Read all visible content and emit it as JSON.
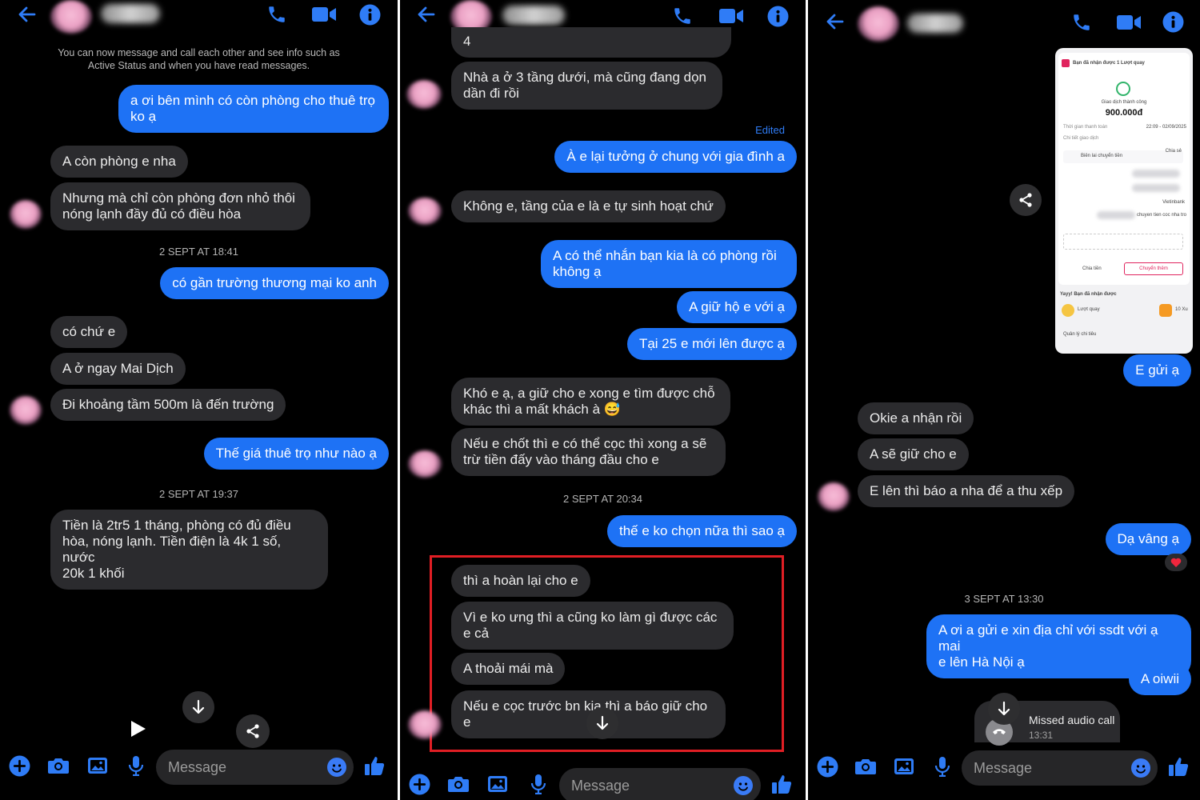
{
  "colors": {
    "accent": "#1e72f5",
    "incoming_bubble": "#2b2b2e",
    "background": "#000000",
    "highlight_border": "#e01e24"
  },
  "header": {
    "icons": [
      "back-arrow-icon",
      "phone-icon",
      "video-camera-icon",
      "info-icon"
    ]
  },
  "composer": {
    "placeholder": "Message",
    "icons": [
      "plus-icon",
      "camera-icon",
      "image-icon",
      "microphone-icon",
      "emoji-icon",
      "thumbs-up-icon"
    ]
  },
  "panel1": {
    "notice_line1": "You can now message and call each other and see info such as",
    "notice_line2": "Active Status and when you have read messages.",
    "m1_l1": "a ơi bên mình có còn phòng cho thuê trọ",
    "m1_l2": "ko ạ",
    "m2": "A còn phòng e nha",
    "m3_l1": "Nhưng mà chỉ còn phòng đơn nhỏ thôi",
    "m3_l2": "nóng lạnh đầy đủ có điều hòa",
    "stamp1": "2 SEPT AT 18:41",
    "m4": "có gần trường thương mại ko anh",
    "m5": "có chứ e",
    "m6": "A ở ngay Mai Dịch",
    "m7": "Đi khoảng tầm 500m là đến trường",
    "m8": "Thế giá thuê trọ như nào ạ",
    "stamp2": "2 SEPT AT 19:37",
    "m9_l1": "Tiền là 2tr5 1 tháng, phòng có đủ điều",
    "m9_l2": "hòa, nóng lạnh. Tiền điện là 4k 1 số, nước",
    "m9_l3": "20k 1 khối"
  },
  "panel2": {
    "m0": "4",
    "m1_l1": "Nhà a ở 3 tầng dưới, mà cũng đang dọn",
    "m1_l2": "dần đi rồi",
    "edited": "Edited",
    "m2": "À e lại tưởng ở chung với gia đình a",
    "m3": "Không e, tầng của e là e tự sinh hoạt chứ",
    "m4_l1": "A có thể nhắn bạn kia là có phòng rồi",
    "m4_l2": "không ạ",
    "m5": "A giữ hộ e với ạ",
    "m6": "Tại 25 e mới lên được ạ",
    "m7_l1": "Khó e ạ, a giữ cho e xong e tìm được chỗ",
    "m7_l2": "khác thì a mất khách à 😅",
    "m8_l1": "Nếu e chốt thì e có thể cọc thì xong a sẽ",
    "m8_l2": "trừ tiền đấy vào tháng đầu cho e",
    "stamp1": "2 SEPT AT 20:34",
    "m9": "thế e ko chọn nữa thì sao ạ",
    "m10": "thì a hoàn lại cho e",
    "m11_l1": "Vì e ko ưng thì a cũng ko làm gì được các",
    "m11_l2": "e cả",
    "m12": "A thoải mái mà",
    "m13_l1": "Nếu e cọc trước bn kia thì a báo giữ cho",
    "m13_l2": "e"
  },
  "panel3": {
    "shot": {
      "title": "Bạn đã nhận được 1 Lượt quay",
      "subtitle": "Giao dịch thành công",
      "amount": "900.000đ",
      "time_label": "Thời gian thanh toán",
      "time_value": "22:09 - 02/09/2025",
      "detail_label": "Chi tiết giao dịch",
      "receipt": "Biên lai chuyển tiền",
      "share": "Chia sẻ",
      "bank": "Vietinbank",
      "note": "chuyen tien coc nha tro",
      "btn_left": "Chia tiền",
      "btn_right": "Chuyển thêm",
      "reward": "Yayy! Bạn đã nhận được",
      "spin": "Lượt quay",
      "coins": "10 Xu",
      "manage": "Quản lý chi tiêu"
    },
    "m1": "E gửi ạ",
    "m2": "Okie a nhận rồi",
    "m3": "A sẽ giữ cho e",
    "m4": "E lên thì báo a nha để a thu xếp",
    "m5": "Dạ vâng ạ",
    "stamp1": "3 SEPT AT 13:30",
    "m6_l1": "A ơi a gửi e xin địa chỉ với ssdt với ạ mai",
    "m6_l2": "e lên Hà Nội ạ",
    "m7": "A oiwii",
    "missed_title": "Missed audio call",
    "missed_time": "13:31"
  }
}
